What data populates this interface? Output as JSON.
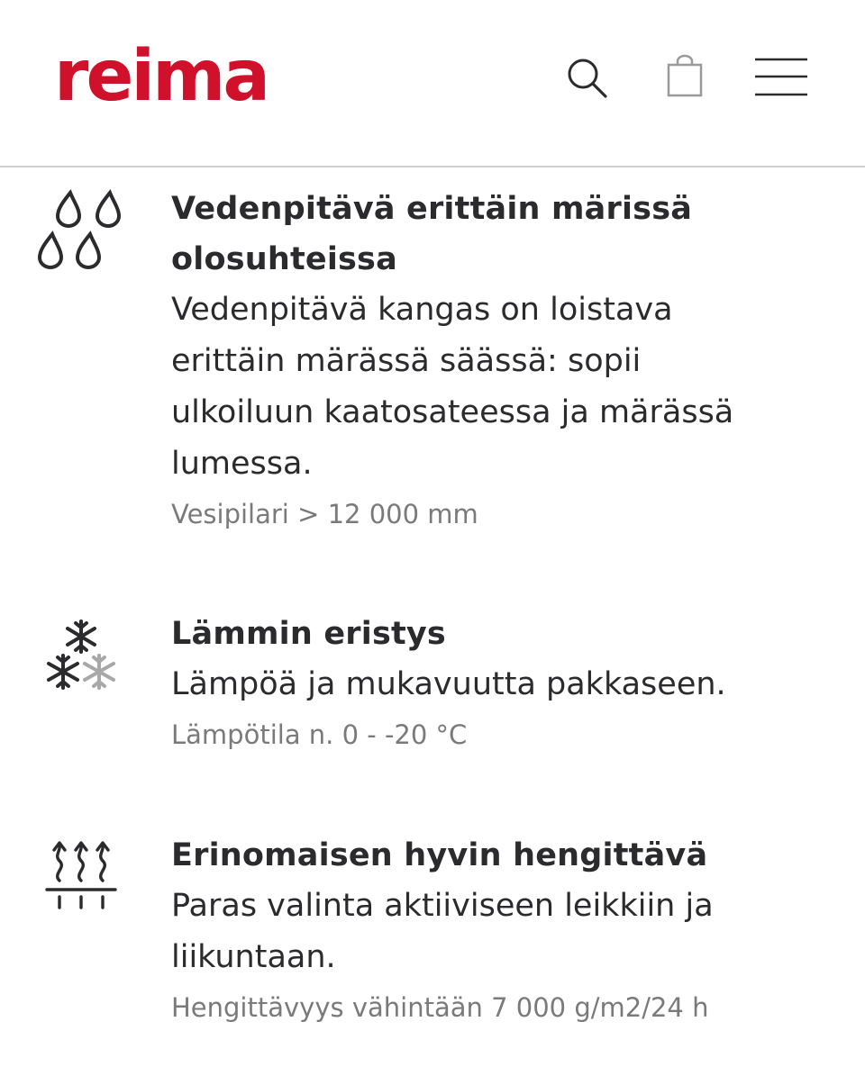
{
  "header": {
    "logo": "reima",
    "brand_color": "#d0112b"
  },
  "icons": {
    "search": "search-icon",
    "bag": "shopping-bag-icon",
    "menu": "hamburger-menu-icon"
  },
  "features": [
    {
      "icon": "raindrops-icon",
      "title_line1": "Vedenpitävä erittäin märissä",
      "title_line2": "olosuhteissa",
      "description": "Vedenpitävä kangas on loistava erittäin märässä säässä: sopii ulkoiluun kaatosateessa ja märässä lumessa.",
      "spec": "Vesipilari > 12 000 mm"
    },
    {
      "icon": "snowflakes-icon",
      "title": "Lämmin eristys",
      "description": "Lämpöä ja mukavuutta pakkaseen.",
      "spec": "Lämpötila n. 0 - -20 °C"
    },
    {
      "icon": "breathable-icon",
      "title": "Erinomaisen hyvin hengittävä",
      "description": "Paras valinta aktiiviseen leikkiin ja liikuntaan.",
      "spec": "Hengittävyys vähintään 7 000 g/m2/24 h"
    }
  ]
}
